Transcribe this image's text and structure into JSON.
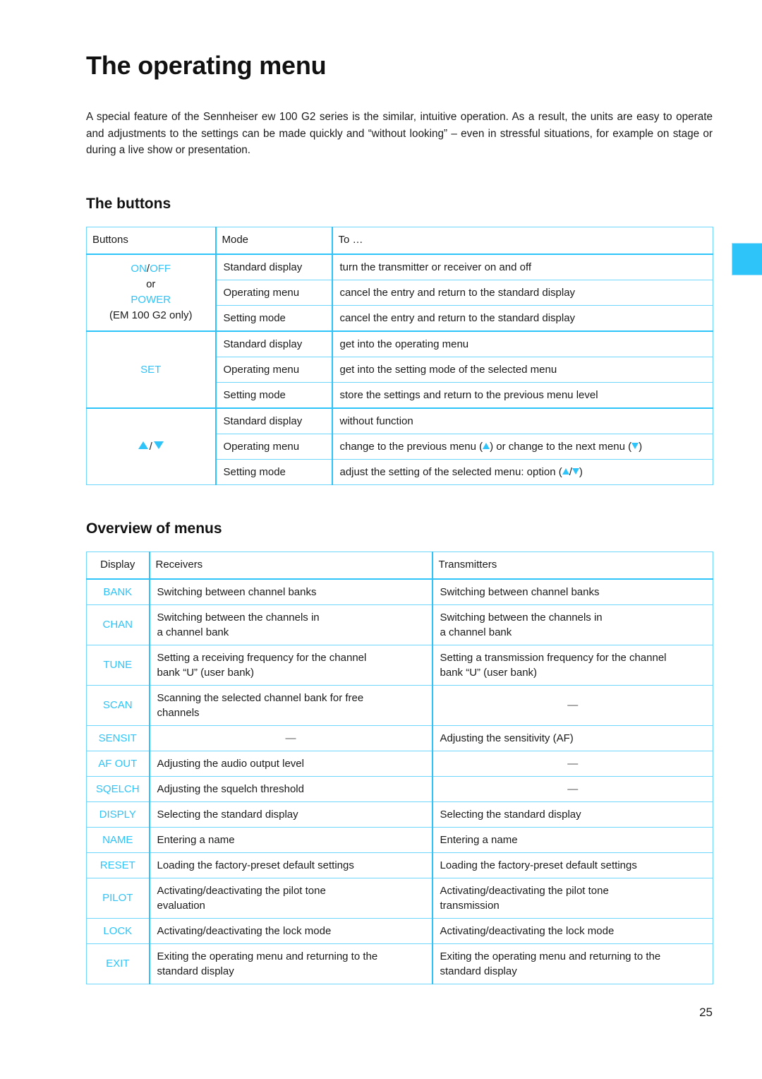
{
  "document": {
    "title": "The operating menu",
    "intro": "A special feature of the Sennheiser ew 100 G2 series is the similar, intuitive operation. As a result, the units are easy to operate and adjustments to the settings can be made quickly and “without looking” – even in stressful situations, for example on stage or during a live show or presentation.",
    "page_number": "25",
    "accent_color": "#2ec4f9"
  },
  "buttons_section": {
    "heading": "The buttons",
    "table": {
      "headers": [
        "Buttons",
        "Mode",
        "To …"
      ],
      "groups": [
        {
          "button_parts": {
            "on": "ON",
            "slash": "/",
            "off": "OFF",
            "or": "or",
            "power": "POWER",
            "note": "(EM 100 G2 only)"
          },
          "rows": [
            {
              "mode": "Standard display",
              "to": "turn the transmitter or receiver on and off"
            },
            {
              "mode": "Operating menu",
              "to": "cancel the entry and return to the standard display"
            },
            {
              "mode": "Setting mode",
              "to": "cancel the entry and return to the standard display"
            }
          ]
        },
        {
          "button_label": "SET",
          "rows": [
            {
              "mode": "Standard display",
              "to": "get into the operating menu"
            },
            {
              "mode": "Operating menu",
              "to": "get into the setting mode of the selected menu"
            },
            {
              "mode": "Setting mode",
              "to": "store the settings and return to the previous menu level"
            }
          ]
        },
        {
          "button_label": "arrows-up-down",
          "rows": [
            {
              "mode": "Standard display",
              "to": "without function"
            },
            {
              "mode": "Operating menu",
              "to_parts": {
                "a": "change to the previous menu (",
                "b": ") or change to the next menu (",
                "c": ")"
              }
            },
            {
              "mode": "Setting mode",
              "to_parts": {
                "a": "adjust the setting of the selected menu: option (",
                "b": "/",
                "c": ")"
              }
            }
          ]
        }
      ]
    }
  },
  "overview_section": {
    "heading": "Overview of menus",
    "table": {
      "headers": [
        "Display",
        "Receivers",
        "Transmitters"
      ],
      "rows": [
        {
          "display": "BANK",
          "receivers": "Switching between channel banks",
          "transmitters": "Switching between channel banks"
        },
        {
          "display": "CHAN",
          "receivers": "Switching between the channels in\na channel bank",
          "transmitters": "Switching between the channels in\na channel bank"
        },
        {
          "display": "TUNE",
          "receivers": "Setting a receiving frequency for the channel\nbank “U” (user bank)",
          "transmitters": "Setting a transmission frequency for the channel\nbank “U” (user bank)"
        },
        {
          "display": "SCAN",
          "receivers": "Scanning the selected channel bank for free\nchannels",
          "transmitters": "—"
        },
        {
          "display": "SENSIT",
          "receivers": "—",
          "transmitters": "Adjusting the sensitivity (AF)"
        },
        {
          "display": "AF OUT",
          "receivers": "Adjusting the audio output level",
          "transmitters": "—"
        },
        {
          "display": "SQELCH",
          "receivers": "Adjusting the squelch threshold",
          "transmitters": "—"
        },
        {
          "display": "DISPLY",
          "receivers": "Selecting the standard display",
          "transmitters": "Selecting the standard display"
        },
        {
          "display": "NAME",
          "receivers": "Entering a name",
          "transmitters": "Entering a name"
        },
        {
          "display": "RESET",
          "receivers": "Loading the factory-preset default settings",
          "transmitters": "Loading the factory-preset default settings"
        },
        {
          "display": "PILOT",
          "receivers": "Activating/deactivating the pilot tone\nevaluation",
          "transmitters": "Activating/deactivating the pilot tone\ntransmission"
        },
        {
          "display": "LOCK",
          "receivers": "Activating/deactivating the lock mode",
          "transmitters": "Activating/deactivating the lock mode"
        },
        {
          "display": "EXIT",
          "receivers": "Exiting the operating menu and returning to the\nstandard display",
          "transmitters": "Exiting the operating menu and returning to the\nstandard display"
        }
      ]
    }
  }
}
